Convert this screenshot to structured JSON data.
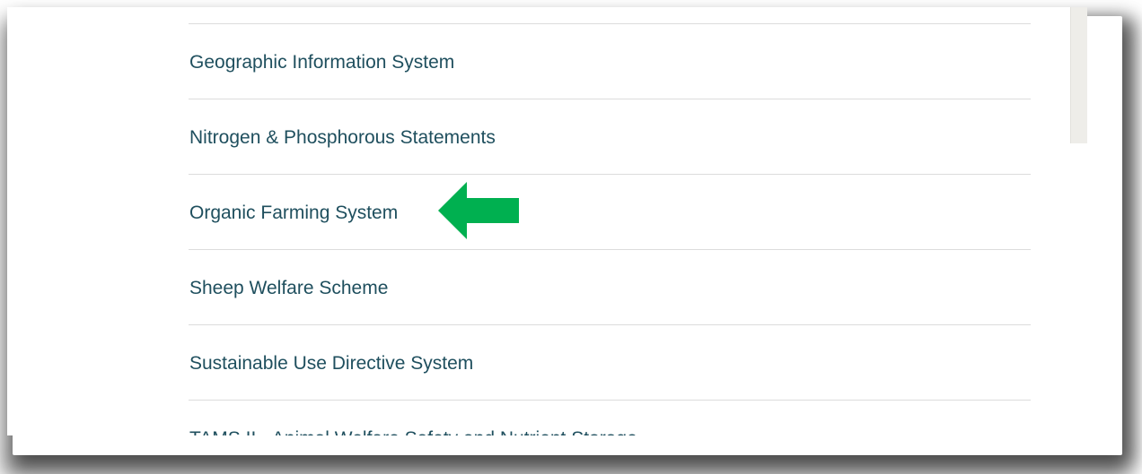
{
  "menu": {
    "items": [
      {
        "label": "Geographic Information System"
      },
      {
        "label": "Nitrogen & Phosphorous Statements"
      },
      {
        "label": "Organic Farming System"
      },
      {
        "label": "Sheep Welfare Scheme"
      },
      {
        "label": "Sustainable Use Directive System"
      },
      {
        "label": "TAMS II - Animal Welfare Safety and Nutrient Storage"
      }
    ],
    "link_color": "#1f4f5e",
    "divider_color": "#dcdcdc"
  },
  "annotation": {
    "icon": "arrow-left-icon",
    "points_to": "Organic Farming System",
    "color": "#00b050"
  },
  "scrollbar": {
    "color": "#eeede9"
  }
}
